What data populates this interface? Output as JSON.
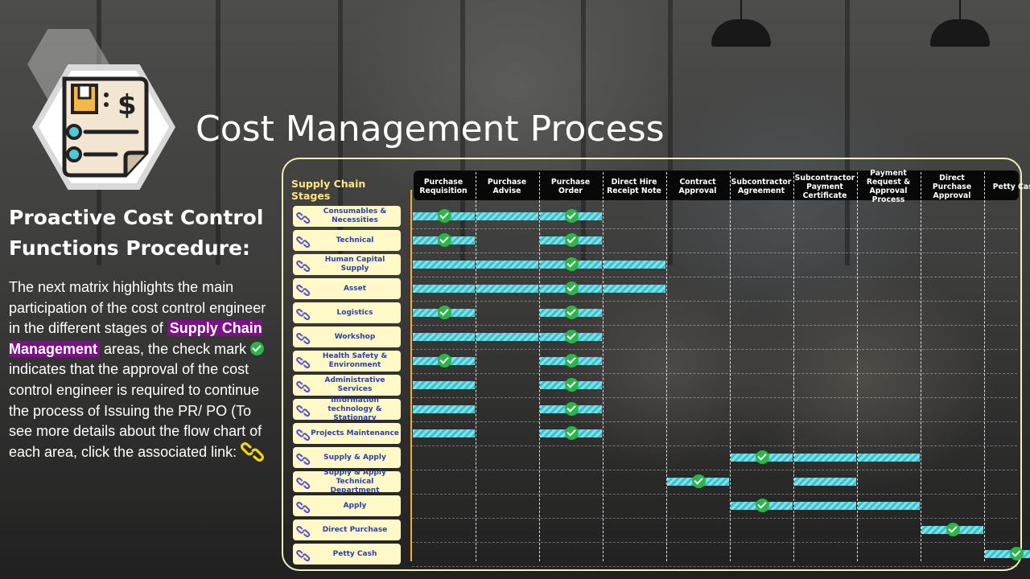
{
  "title": "Cost Management Process",
  "heading": "Proactive Cost Control Functions Procedure:",
  "body": {
    "part1": "The next matrix highlights the main participation of the cost control engineer in the different stages of ",
    "highlight": "Supply Chain Management",
    "part2": " areas, the check mark ",
    "part3": " indicates that the approval of the cost control engineer is required to continue the process of Issuing the PR/ PO (To see more details about the flow chart of each area, click the associated link: "
  },
  "colors": {
    "accent_bar": "#3dbfcb",
    "check": "#2bb54a",
    "row_button": "#fff9c8",
    "highlight": "#7a1184",
    "axis": "#f2b313",
    "panel_border": "#f4f0b8"
  },
  "matrix": {
    "stages_label": "Supply Chain Stages",
    "columns": [
      "Purchase Requisition",
      "Purchase Advise",
      "Purchase Order",
      "Direct Hire Receipt Note",
      "Contract Approval",
      "Subcontractor Agreement",
      "Subcontractor Payment Certificate",
      "Payment Request & Approval Process",
      "Direct Purchase Approval",
      "Petty Cash"
    ],
    "rows": [
      {
        "label": "Consumables & Necessities",
        "icon": "chain-link-icon",
        "active_columns": [
          1,
          2,
          3
        ],
        "check_columns": [
          1,
          3
        ]
      },
      {
        "label": "Technical",
        "icon": "chain-link-icon",
        "active_columns": [
          1,
          3
        ],
        "check_columns": [
          1,
          3
        ]
      },
      {
        "label": "Human Capital Supply",
        "icon": "chain-link-icon",
        "active_columns": [
          1,
          2,
          3,
          4
        ],
        "check_columns": [
          3
        ]
      },
      {
        "label": "Asset",
        "icon": "chain-link-icon",
        "active_columns": [
          1,
          2,
          3,
          4
        ],
        "check_columns": [
          3
        ]
      },
      {
        "label": "Logistics",
        "icon": "chain-link-icon",
        "active_columns": [
          1,
          3
        ],
        "check_columns": [
          1,
          3
        ]
      },
      {
        "label": "Workshop",
        "icon": "chain-link-icon",
        "active_columns": [
          1,
          2,
          3
        ],
        "check_columns": [
          3
        ]
      },
      {
        "label": "Health Safety & Environment",
        "icon": "chain-link-icon",
        "active_columns": [
          1,
          3
        ],
        "check_columns": [
          1,
          3
        ]
      },
      {
        "label": "Administrative Services",
        "icon": "chain-link-icon",
        "active_columns": [
          1,
          3
        ],
        "check_columns": [
          3
        ]
      },
      {
        "label": "Information technology & Stationary",
        "icon": "chain-link-icon",
        "active_columns": [
          1,
          3
        ],
        "check_columns": [
          3
        ]
      },
      {
        "label": "Projects Maintenance",
        "icon": "chain-link-icon",
        "active_columns": [
          1,
          3
        ],
        "check_columns": [
          3
        ]
      },
      {
        "label": "Supply & Apply",
        "icon": "chain-link-icon",
        "active_columns": [
          6,
          7,
          8
        ],
        "check_columns": [
          6
        ]
      },
      {
        "label": "Supply & Apply Technical Department",
        "icon": "chain-link-icon",
        "active_columns": [
          5,
          7
        ],
        "check_columns": [
          5
        ]
      },
      {
        "label": "Apply",
        "icon": "chain-link-icon",
        "active_columns": [
          6,
          7,
          8
        ],
        "check_columns": [
          6
        ]
      },
      {
        "label": "Direct Purchase",
        "icon": "chain-link-icon",
        "active_columns": [
          9
        ],
        "check_columns": [
          9
        ]
      },
      {
        "label": "Petty Cash",
        "icon": "chain-link-icon",
        "active_columns": [
          10
        ],
        "check_columns": [
          10
        ]
      }
    ]
  }
}
